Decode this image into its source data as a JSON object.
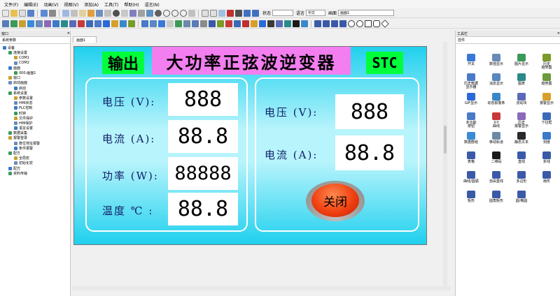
{
  "menu": [
    "文件(F)",
    "编辑(E)",
    "动画(V)",
    "视图(V)",
    "添加(A)",
    "工具(T)",
    "帮助(H)",
    "语言(N)"
  ],
  "toolbar": {
    "status_label": "状态",
    "status_value": "",
    "language_label": "语言",
    "language_value": "中文",
    "screen_label": "画面",
    "screen_value": "画面1"
  },
  "left_panel": {
    "header": "窗口",
    "tab": "系统参数",
    "tree": [
      {
        "label": "设备",
        "indent": 0
      },
      {
        "label": "连接设置",
        "indent": 1
      },
      {
        "label": "COM1",
        "indent": 2
      },
      {
        "label": "COM2",
        "indent": 2
      },
      {
        "label": "画面",
        "indent": 1
      },
      {
        "label": "000:画面1",
        "indent": 2
      },
      {
        "label": "窗口",
        "indent": 1
      },
      {
        "label": "启动画面",
        "indent": 1
      },
      {
        "label": "启动",
        "indent": 2
      },
      {
        "label": "系统设置",
        "indent": 1
      },
      {
        "label": "参数设置",
        "indent": 2
      },
      {
        "label": "HMI状态",
        "indent": 2
      },
      {
        "label": "PLC控制",
        "indent": 2
      },
      {
        "label": "时钟",
        "indent": 2
      },
      {
        "label": "文件保护",
        "indent": 2
      },
      {
        "label": "HMI保护",
        "indent": 2
      },
      {
        "label": "语言设置",
        "indent": 2
      },
      {
        "label": "数据采集",
        "indent": 1
      },
      {
        "label": "报警登录",
        "indent": 1
      },
      {
        "label": "数位地址报警",
        "indent": 2
      },
      {
        "label": "条件报警",
        "indent": 2
      },
      {
        "label": "配方",
        "indent": 1
      },
      {
        "label": "全局宏",
        "indent": 2
      },
      {
        "label": "初始化宏",
        "indent": 2
      },
      {
        "label": "配方",
        "indent": 1
      },
      {
        "label": "资料传输",
        "indent": 1
      }
    ]
  },
  "doc_tab": "画面1",
  "screen": {
    "output_label": "输出",
    "title": "大功率正弦波逆变器",
    "brand": "STC",
    "left_rows": [
      {
        "label": "电压 (V):",
        "value": "888"
      },
      {
        "label": "电流 (A):",
        "value": "88.8"
      },
      {
        "label": "功率 (W):",
        "value": "88888"
      },
      {
        "label": "温度 ℃ :",
        "value": "88.8"
      }
    ],
    "right_rows": [
      {
        "label": "电压 (V):",
        "value": "888"
      },
      {
        "label": "电流 (A):",
        "value": "88.8"
      }
    ],
    "close_button": "关闭"
  },
  "toolbox": {
    "header": "工具栏",
    "tab": "控件",
    "items": [
      {
        "label": "开关",
        "icon": "power-icon",
        "color": "#3a78d8"
      },
      {
        "label": "数值显示",
        "icon": "numeric-display-icon",
        "color": "#6a8ab8"
      },
      {
        "label": "图片显示",
        "icon": "picture-icon",
        "color": "#3a9a5a"
      },
      {
        "label": "历史\n趋势图",
        "icon": "trend-icon",
        "color": "#7a9a2a"
      },
      {
        "label": "历史数据\n显示器",
        "icon": "history-data-icon",
        "color": "#4a7ac8"
      },
      {
        "label": "消息显示",
        "icon": "message-icon",
        "color": "#5a88c0"
      },
      {
        "label": "图表",
        "icon": "chart-icon",
        "color": "#2a8a8a"
      },
      {
        "label": "趋势图",
        "icon": "trend-chart-icon",
        "color": "#6a9a3a"
      },
      {
        "label": "GIF显示",
        "icon": "gif-icon",
        "color": "#2a6ad8"
      },
      {
        "label": "动态报警条",
        "icon": "alarm-bar-icon",
        "color": "#3a88c8"
      },
      {
        "label": "流动块",
        "icon": "flow-block-icon",
        "color": "#5a6ab8"
      },
      {
        "label": "报警显示",
        "icon": "alarm-display-icon",
        "color": "#d8a02a"
      },
      {
        "label": "多功能\n按钮",
        "icon": "multi-button-icon",
        "color": "#4a7ac8"
      },
      {
        "label": "X-Y\n曲线",
        "icon": "xy-curve-icon",
        "color": "#c83a3a"
      },
      {
        "label": "历史\n报警显示",
        "icon": "history-alarm-icon",
        "color": "#8a6ab8"
      },
      {
        "label": "下拉框",
        "icon": "dropdown-icon",
        "color": "#3a6ab8"
      },
      {
        "label": "数据群组",
        "icon": "data-group-icon",
        "color": "#3a8ad8"
      },
      {
        "label": "移动轨道",
        "icon": "track-icon",
        "color": "#6a8aa8"
      },
      {
        "label": "静态文本",
        "icon": "static-text-icon",
        "color": "#2a2a2a"
      },
      {
        "label": "刻度",
        "icon": "scale-icon",
        "color": "#3a7ac8"
      },
      {
        "label": "表格",
        "icon": "table-icon",
        "color": "#3a5aa8"
      },
      {
        "label": "二维码",
        "icon": "qrcode-icon",
        "color": "#1a1a1a"
      },
      {
        "label": "直线",
        "icon": "line-icon",
        "color": "#3a5aa8"
      },
      {
        "label": "折线",
        "icon": "polyline-icon",
        "color": "#3a5aa8"
      },
      {
        "label": "曲线/圆弧",
        "icon": "arc-icon",
        "color": "#3a5aa8"
      },
      {
        "label": "自由直线",
        "icon": "free-line-icon",
        "color": "#3a5aa8"
      },
      {
        "label": "多边形",
        "icon": "polygon-icon",
        "color": "#3a5aa8"
      },
      {
        "label": "扇形",
        "icon": "sector-icon",
        "color": "#3a5aa8"
      },
      {
        "label": "矩形",
        "icon": "rectangle-icon",
        "color": "#3a5aa8"
      },
      {
        "label": "圆角矩形",
        "icon": "rounded-rect-icon",
        "color": "#3a5aa8"
      },
      {
        "label": "圆/椭圆",
        "icon": "ellipse-icon",
        "color": "#3a5aa8"
      }
    ]
  }
}
